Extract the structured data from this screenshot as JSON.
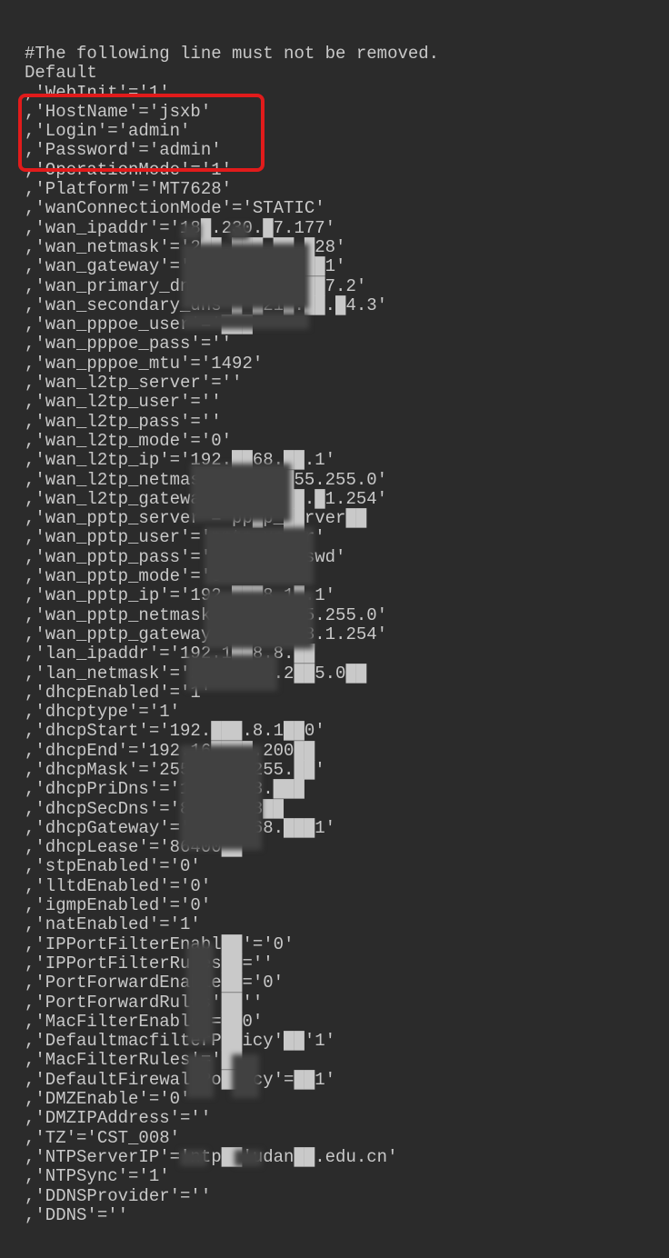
{
  "lines": [
    "#The following line must not be removed.",
    "Default",
    ",'WebInit'='1'",
    ",'HostName'='jsxb'",
    ",'Login'='admin'",
    ",'Password'='admin'",
    ",'OperationMode'='1'",
    ",'Platform'='MT7628'",
    ",'wanConnectionMode'='STATIC'",
    ",'wan_ipaddr'='18█.230.█7.177'",
    ",'wan_netmask'='2██.███.██.█28'",
    ",'wan_gateway'='183.██.███.██1'",
    ",'wan_primary_dns'='█1█.██.██7.2'",
    ",'wan_secondary_dns'█'█21█.██.█4.3'",
    ",'wan_pppoe_user'='███",
    ",'wan_pppoe_pass'=''",
    ",'wan_pppoe_mtu'='1492'",
    ",'wan_l2tp_server'=''",
    ",'wan_l2tp_user'=''",
    ",'wan_l2tp_pass'=''",
    ",'wan_l2tp_mode'='0'",
    ",'wan_l2tp_ip'='192.██68.██.1'",
    ",'wan_l2tp_netmask'='2██.█55.255.0'",
    ",'wan_l2tp_gateway'='1██.██.█1.254'",
    ",'wan_pptp_server'='pp█p_██rver██",
    ",'wan_pptp_user'='pptp_us██r'",
    ",'wan_pptp_pass'='ppt█_pa██swd'",
    ",'wan_pptp_mode'='0'",
    ",'wan_pptp_ip'='192.███8.1█.1'",
    ",'wan_pptp_netmask'=█2██.█55.255.0'",
    ",'wan_pptp_gateway'=█192.██8.1.254'",
    ",'lan_ipaddr'='192.1██8.8.██",
    ",'lan_netmask'='255.██55.2██5.0██",
    ",'dhcpEnabled'='1'",
    ",'dhcptype'='1'",
    ",'dhcpStart'='192.███.8.1██0'",
    ",'dhcpEnd'='192.16████.200██",
    ",'dhcpMask'='255.25██.255.██'",
    ",'dhcpPriDns'='192.██.8.███",
    ",'dhcpSecDns'='8.8.██.8██",
    ",'dhcpGateway'='192██168.███1'",
    ",'dhcpLease'='86400██",
    ",'stpEnabled'='0'",
    ",'lltdEnabled'='0'",
    ",'igmpEnabled'='0'",
    ",'natEnabled'='1'",
    ",'IPPortFilterEnabl██'='0'",
    ",'IPPortFilterRules██=''",
    ",'PortForwardEnable██='0'",
    ",'PortForwardRules'██''",
    ",'MacFilterEnable'=██0'",
    ",'DefaultmacfilterP██icy'██'1'",
    ",'MacFilterRules'='██",
    ",'DefaultFirewallPo███cy'=██1'",
    ",'DMZEnable'='0'",
    ",'DMZIPAddress'=''",
    ",'TZ'='CST_008'",
    ",'NTPServerIP'='ntp██'udan██.edu.cn'",
    ",'NTPSync'='1'",
    ",'DDNSProvider'=''",
    ",'DDNS'=''"
  ]
}
